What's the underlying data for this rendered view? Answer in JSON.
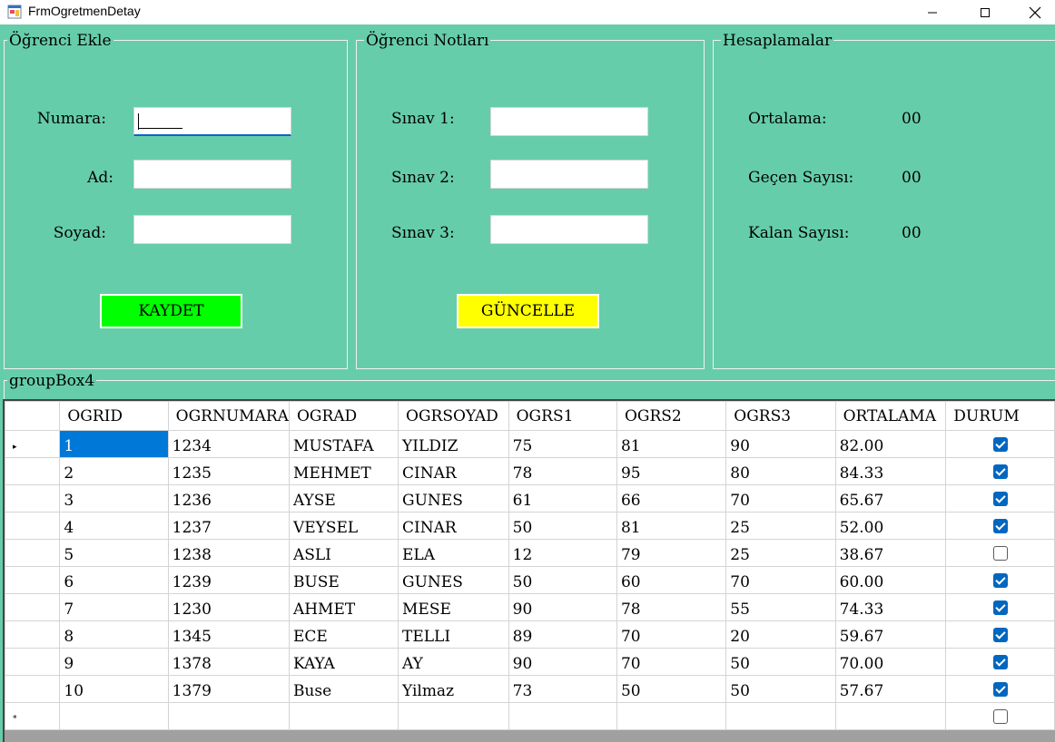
{
  "window": {
    "title": "FrmOgretmenDetay"
  },
  "add_group": {
    "title": "Öğrenci Ekle",
    "numara_label": "Numara:",
    "ad_label": "Ad:",
    "soyad_label": "Soyad:",
    "numara_value": "",
    "ad_value": "",
    "soyad_value": "",
    "save_label": "KAYDET",
    "save_color": "#00ff00"
  },
  "grades_group": {
    "title": "Öğrenci Notları",
    "sinav1_label": "Sınav 1:",
    "sinav2_label": "Sınav 2:",
    "sinav3_label": "Sınav 3:",
    "sinav1_value": "",
    "sinav2_value": "",
    "sinav3_value": "",
    "update_label": "GÜNCELLE",
    "update_color": "#ffff00"
  },
  "calc_group": {
    "title": "Hesaplamalar",
    "ortalama_label": "Ortalama:",
    "ortalama_value": "00",
    "gecen_label": "Geçen Sayısı:",
    "gecen_value": "00",
    "kalan_label": "Kalan Sayısı:",
    "kalan_value": "00"
  },
  "grid_group": {
    "title": "groupBox4"
  },
  "grid": {
    "columns": [
      "OGRID",
      "OGRNUMARA",
      "OGRAD",
      "OGRSOYAD",
      "OGRS1",
      "OGRS2",
      "OGRS3",
      "ORTALAMA",
      "DURUM"
    ],
    "rows": [
      [
        "1",
        "1234",
        "MUSTAFA",
        "YILDIZ",
        "75",
        "81",
        "90",
        "82.00",
        true
      ],
      [
        "2",
        "1235",
        "MEHMET",
        "CINAR",
        "78",
        "95",
        "80",
        "84.33",
        true
      ],
      [
        "3",
        "1236",
        "AYSE",
        "GUNES",
        "61",
        "66",
        "70",
        "65.67",
        true
      ],
      [
        "4",
        "1237",
        "VEYSEL",
        "CINAR",
        "50",
        "81",
        "25",
        "52.00",
        true
      ],
      [
        "5",
        "1238",
        "ASLI",
        "ELA",
        "12",
        "79",
        "25",
        "38.67",
        false
      ],
      [
        "6",
        "1239",
        "BUSE",
        "GUNES",
        "50",
        "60",
        "70",
        "60.00",
        true
      ],
      [
        "7",
        "1230",
        "AHMET",
        "MESE",
        "90",
        "78",
        "55",
        "74.33",
        true
      ],
      [
        "8",
        "1345",
        "ECE",
        "TELLI",
        "89",
        "70",
        "20",
        "59.67",
        true
      ],
      [
        "9",
        "1378",
        "KAYA",
        "AY",
        "90",
        "70",
        "50",
        "70.00",
        true
      ],
      [
        "10",
        "1379",
        "Buse",
        "Yilmaz",
        "73",
        "50",
        "50",
        "57.67",
        true
      ]
    ],
    "new_row_marker": "*",
    "current_row_marker": "▸"
  }
}
